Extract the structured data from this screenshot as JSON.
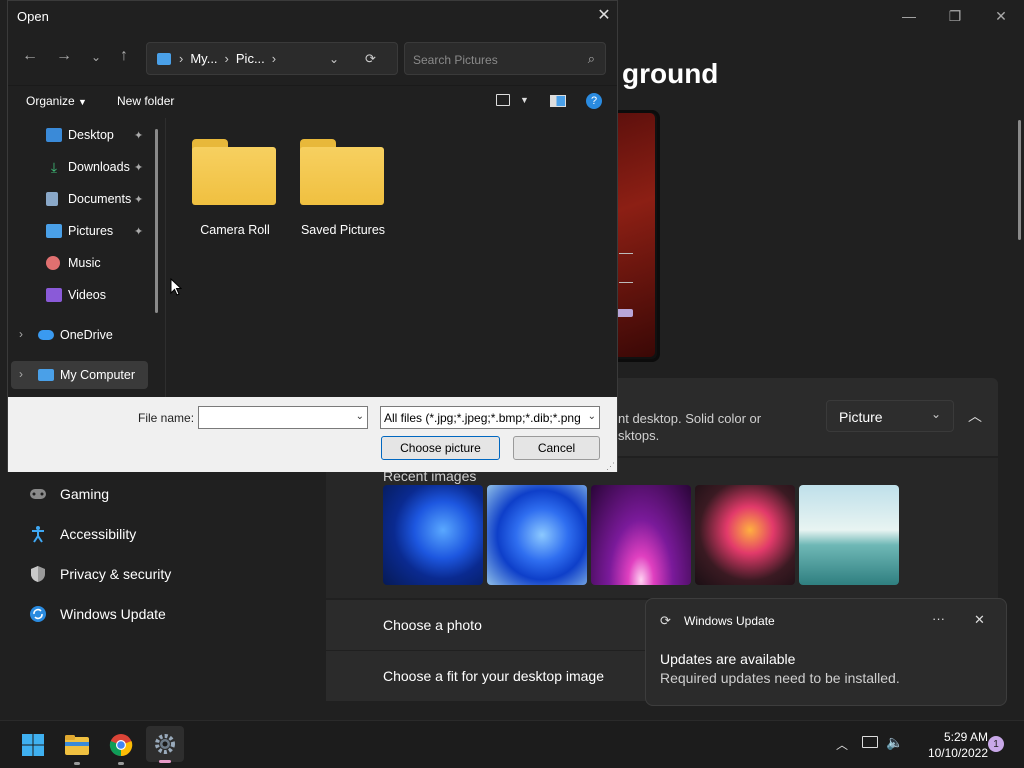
{
  "settings": {
    "heading": "ground",
    "window_controls": {
      "minimize": "—",
      "maximize": "❐",
      "close": "✕"
    },
    "background_desc": "nt desktop. Solid color or\nsktops.",
    "background_select": "Picture",
    "recent_images_label": "Recent images",
    "choose_photo": "Choose a photo",
    "choose_fit": "Choose a fit for your desktop image",
    "nav_items": [
      "Gaming",
      "Accessibility",
      "Privacy & security",
      "Windows Update"
    ]
  },
  "dialog": {
    "title": "Open",
    "close": "✕",
    "address": {
      "seg1": "My...",
      "seg2": "Pic..."
    },
    "search_placeholder": "Search Pictures",
    "toolbar": {
      "organize": "Organize",
      "new_folder": "New folder"
    },
    "nav_pane": [
      "Desktop",
      "Downloads",
      "Documents",
      "Pictures",
      "Music",
      "Videos",
      "OneDrive",
      "My Computer"
    ],
    "folders": [
      "Camera Roll",
      "Saved Pictures"
    ],
    "file_name_label": "File name:",
    "file_name_value": "",
    "file_type": "All files (*.jpg;*.jpeg;*.bmp;*.dib;*.png",
    "choose_button": "Choose picture",
    "cancel_button": "Cancel"
  },
  "toast": {
    "app": "Windows Update",
    "title": "Updates are available",
    "body": "Required updates need to be installed.",
    "more": "···",
    "close": "✕"
  },
  "taskbar": {
    "time": "5:29 AM",
    "date": "10/10/2022",
    "notification_count": "1"
  },
  "colors": {
    "accent": "#0067c0",
    "folder": "#f0c040"
  }
}
